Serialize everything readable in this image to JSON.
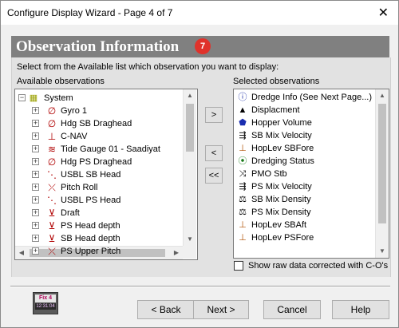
{
  "window": {
    "title": "Configure Display Wizard - Page 4 of 7",
    "close_glyph": "✕"
  },
  "header": {
    "title": "Observation Information",
    "step_number": "7",
    "band_color": "#808080",
    "badge_color": "#e0322b"
  },
  "instruction": "Select from the Available list which observation you want to display:",
  "available": {
    "label": "Available observations",
    "items": [
      {
        "label": "System",
        "icon": "system-folder-icon",
        "glyph": "▦",
        "expander": "−"
      },
      {
        "label": "Gyro 1",
        "icon": "gyro-icon",
        "glyph": "∅",
        "expander": "+"
      },
      {
        "label": "Hdg SB Draghead",
        "icon": "heading-icon",
        "glyph": "∅",
        "expander": "+"
      },
      {
        "label": "C-NAV",
        "icon": "gps-icon",
        "glyph": "⊥",
        "expander": "+"
      },
      {
        "label": "Tide Gauge 01 - Saadiyat",
        "icon": "tide-gauge-icon",
        "glyph": "≋",
        "expander": "+"
      },
      {
        "label": "Hdg PS Draghead",
        "icon": "heading-icon",
        "glyph": "∅",
        "expander": "+"
      },
      {
        "label": "USBL SB Head",
        "icon": "usbl-icon",
        "glyph": "⋱",
        "expander": "+"
      },
      {
        "label": "Pitch Roll",
        "icon": "pitch-roll-icon",
        "glyph": "⤫",
        "expander": "+"
      },
      {
        "label": "USBL PS Head",
        "icon": "usbl-icon",
        "glyph": "⋱",
        "expander": "+"
      },
      {
        "label": "Draft",
        "icon": "draft-icon",
        "glyph": "⊻",
        "expander": "+"
      },
      {
        "label": "PS Head depth",
        "icon": "depth-icon",
        "glyph": "⊻",
        "expander": "+"
      },
      {
        "label": "SB Head depth",
        "icon": "depth-icon",
        "glyph": "⊻",
        "expander": "+"
      },
      {
        "label": "PS Upper Pitch",
        "icon": "pitch-icon",
        "glyph": "⤫",
        "expander": "+"
      },
      {
        "label": "",
        "icon": "pitch-icon",
        "glyph": "⤫",
        "expander": "+"
      }
    ]
  },
  "selected": {
    "label": "Selected observations",
    "items": [
      {
        "label": "Dredge Info (See Next Page...)",
        "icon": "info-icon",
        "glyph": "ⓘ",
        "color": "#1c2fa8"
      },
      {
        "label": "Displacment",
        "icon": "weight-icon",
        "glyph": "▲",
        "color": "#000000"
      },
      {
        "label": "Hopper Volume",
        "icon": "hopper-volume-icon",
        "glyph": "⬟",
        "color": "#1a2db0"
      },
      {
        "label": "SB Mix Velocity",
        "icon": "velocity-icon",
        "glyph": "⇶",
        "color": "#000000"
      },
      {
        "label": "HopLev SBFore",
        "icon": "level-icon",
        "glyph": "⊥",
        "color": "#b05000"
      },
      {
        "label": "Dredging Status",
        "icon": "traffic-light-icon",
        "glyph": "⦿",
        "color": "#1a7a1a"
      },
      {
        "label": "PMO Stb",
        "icon": "pmo-icon",
        "glyph": "⤨",
        "color": "#000000"
      },
      {
        "label": "PS Mix Velocity",
        "icon": "velocity-icon",
        "glyph": "⇶",
        "color": "#000000"
      },
      {
        "label": "SB Mix Density",
        "icon": "density-icon",
        "glyph": "⚖",
        "color": "#000000"
      },
      {
        "label": "PS Mix Density",
        "icon": "density-icon",
        "glyph": "⚖",
        "color": "#000000"
      },
      {
        "label": "HopLev SBAft",
        "icon": "level-icon",
        "glyph": "⊥",
        "color": "#b05000"
      },
      {
        "label": "HopLev PSFore",
        "icon": "level-icon",
        "glyph": "⊥",
        "color": "#b05000"
      }
    ]
  },
  "transfer": {
    "add": ">",
    "remove": "<",
    "remove_all": "<<"
  },
  "checkbox": {
    "label": "Show raw data corrected with C-O's",
    "checked": false
  },
  "logo": {
    "text_top": "Fix 4",
    "text_bottom": "12:31:04"
  },
  "buttons": {
    "back": "< Back",
    "next": "Next >",
    "cancel": "Cancel",
    "help": "Help"
  }
}
